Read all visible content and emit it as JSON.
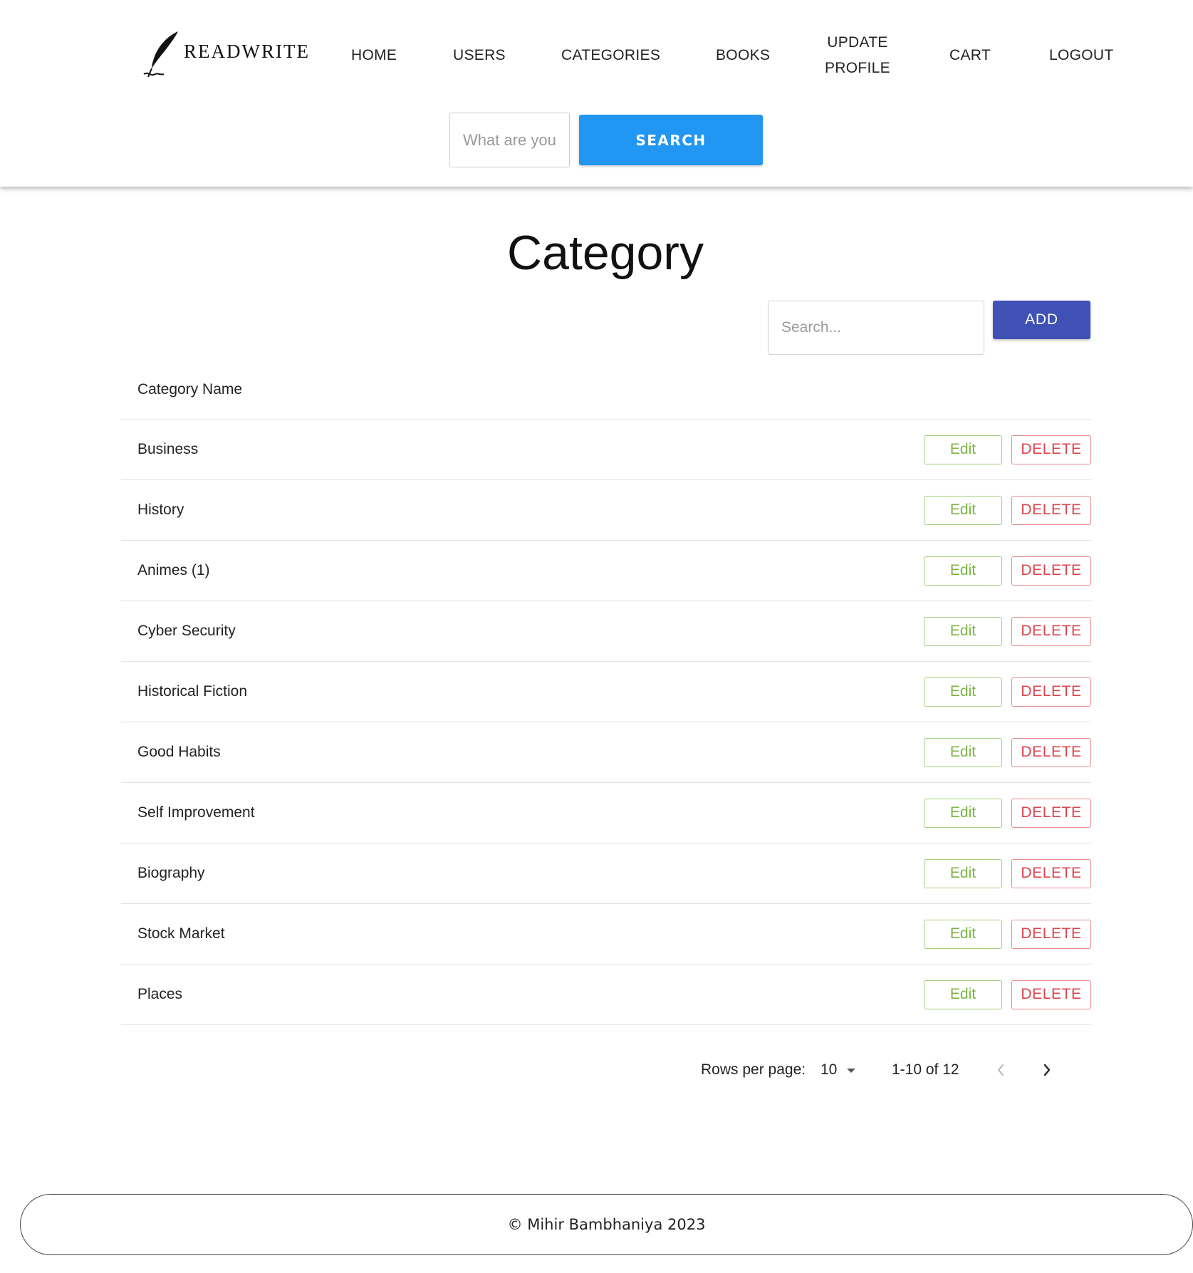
{
  "brand": {
    "name": "READWRITE",
    "logo_icon": "quill-pen-icon"
  },
  "nav": {
    "home": "HOME",
    "users": "USERS",
    "categories": "CATEGORIES",
    "books": "BOOKS",
    "update_profile_line1": "UPDATE",
    "update_profile_line2": "PROFILE",
    "cart": "CART",
    "logout": "LOGOUT"
  },
  "top_search": {
    "placeholder": "What are you",
    "button_label": "SEARCH"
  },
  "main": {
    "title": "Category",
    "search_placeholder": "Search...",
    "add_label": "ADD",
    "column_header": "Category Name",
    "edit_label": "Edit",
    "delete_label": "DELETE",
    "rows": [
      {
        "name": "Business"
      },
      {
        "name": "History"
      },
      {
        "name": "Animes (1)"
      },
      {
        "name": "Cyber Security"
      },
      {
        "name": "Historical Fiction"
      },
      {
        "name": "Good Habits"
      },
      {
        "name": "Self Improvement"
      },
      {
        "name": "Biography"
      },
      {
        "name": "Stock Market"
      },
      {
        "name": "Places"
      }
    ]
  },
  "pagination": {
    "rows_per_page_label": "Rows per page:",
    "rows_per_page_value": "10",
    "range": "1-10 of 12"
  },
  "footer": {
    "text": "© Mihir Bambhaniya 2023"
  },
  "colors": {
    "search_button": "#2196f3",
    "add_button": "#3f51b5",
    "edit": "#7cb342",
    "delete": "#d9464f"
  }
}
